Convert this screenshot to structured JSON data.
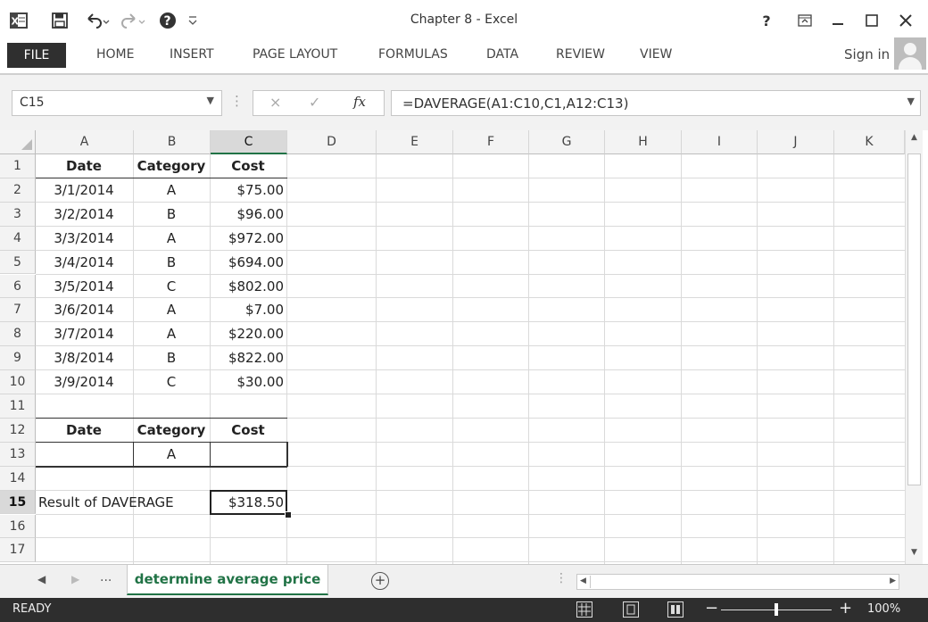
{
  "window": {
    "title": "Chapter 8 - Excel",
    "help_label": "?"
  },
  "ribbon": {
    "tabs": [
      "FILE",
      "HOME",
      "INSERT",
      "PAGE LAYOUT",
      "FORMULAS",
      "DATA",
      "REVIEW",
      "VIEW"
    ],
    "sign_in": "Sign in"
  },
  "formula_bar": {
    "name_box": "C15",
    "cancel_icon": "×",
    "enter_icon": "✓",
    "fx_label": "fx",
    "formula": "=DAVERAGE(A1:C10,C1,A12:C13)"
  },
  "grid": {
    "columns": [
      "A",
      "B",
      "C",
      "D",
      "E",
      "F",
      "G",
      "H",
      "I",
      "J",
      "K"
    ],
    "selected_column": "C",
    "rows": [
      "1",
      "2",
      "3",
      "4",
      "5",
      "6",
      "7",
      "8",
      "9",
      "10",
      "11",
      "12",
      "13",
      "14",
      "15",
      "16",
      "17"
    ],
    "selected_row": "15",
    "data_header": [
      "Date",
      "Category",
      "Cost"
    ],
    "data_rows": [
      [
        "3/1/2014",
        "A",
        "$75.00"
      ],
      [
        "3/2/2014",
        "B",
        "$96.00"
      ],
      [
        "3/3/2014",
        "A",
        "$972.00"
      ],
      [
        "3/4/2014",
        "B",
        "$694.00"
      ],
      [
        "3/5/2014",
        "C",
        "$802.00"
      ],
      [
        "3/6/2014",
        "A",
        "$7.00"
      ],
      [
        "3/7/2014",
        "A",
        "$220.00"
      ],
      [
        "3/8/2014",
        "B",
        "$822.00"
      ],
      [
        "3/9/2014",
        "C",
        "$30.00"
      ]
    ],
    "criteria_header": [
      "Date",
      "Category",
      "Cost"
    ],
    "criteria_row": [
      "",
      "A",
      ""
    ],
    "result_label": "Result of DAVERAGE",
    "result_value": "$318.50"
  },
  "sheet_tabs": {
    "overflow": "...",
    "active": "determine average price",
    "add_icon": "+"
  },
  "status_bar": {
    "status": "READY",
    "zoom": "100%"
  }
}
